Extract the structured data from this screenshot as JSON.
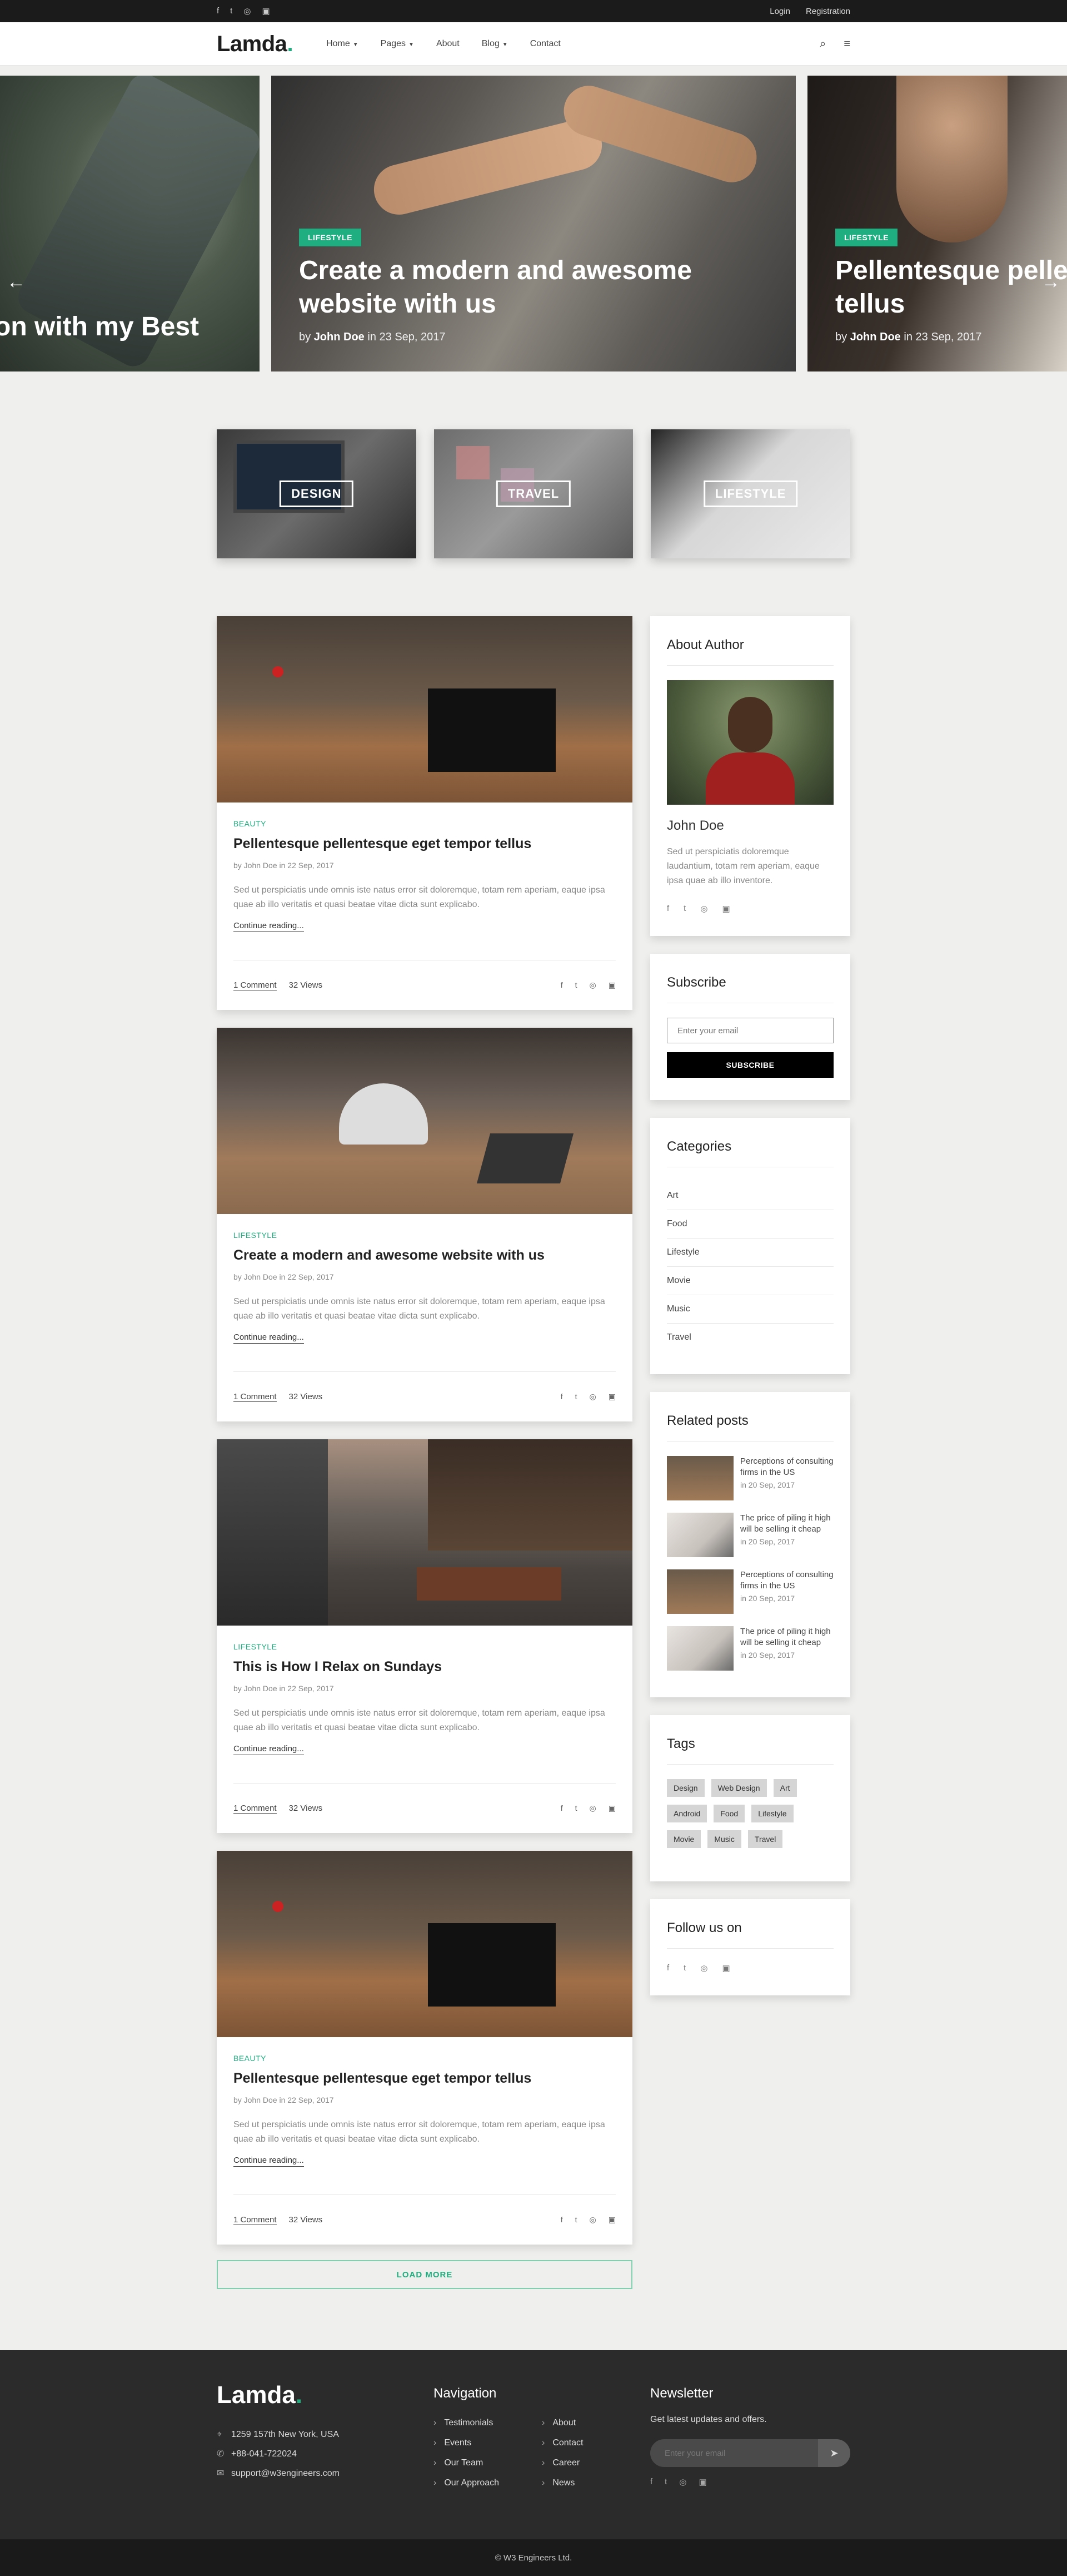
{
  "topbar": {
    "social_icons": [
      "f",
      "t",
      "◎",
      "▣"
    ],
    "login": "Login",
    "registration": "Registration"
  },
  "header": {
    "logo": "Lamda",
    "logo_dot": ".",
    "nav": [
      {
        "label": "Home",
        "has_dropdown": true
      },
      {
        "label": "Pages",
        "has_dropdown": true
      },
      {
        "label": "About",
        "has_dropdown": false
      },
      {
        "label": "Blog",
        "has_dropdown": true
      },
      {
        "label": "Contact",
        "has_dropdown": false
      }
    ],
    "search_icon": "⌕",
    "menu_icon": "≡"
  },
  "hero": {
    "slides": [
      {
        "badge": "",
        "title": "on with my Best",
        "author": "",
        "date": ""
      },
      {
        "badge": "LIFESTYLE",
        "title_line1": "Create a modern and awesome",
        "title_line2": "website with us",
        "by": "by",
        "author": "John Doe",
        "in": "in",
        "date": "23 Sep, 2017"
      },
      {
        "badge": "LIFESTYLE",
        "title_line1": "Pellentesque pellen",
        "title_line2": "tellus",
        "by": "by",
        "author": "John Doe",
        "in": "in",
        "date": "23 Sep, 2017"
      }
    ],
    "prev_arrow": "←",
    "next_arrow": "→"
  },
  "categories": [
    {
      "label": "DESIGN"
    },
    {
      "label": "TRAVEL"
    },
    {
      "label": "LIFESTYLE"
    }
  ],
  "posts": [
    {
      "category": "BEAUTY",
      "title": "Pellentesque pellentesque eget tempor tellus",
      "meta": "by John Doe in 22 Sep, 2017",
      "excerpt": "Sed ut perspiciatis unde omnis iste natus error sit doloremque, totam rem aperiam, eaque ipsa quae ab illo veritatis et quasi beatae vitae dicta sunt explicabo.",
      "more": "Continue reading...",
      "comments": "1 Comment",
      "views": "32 Views"
    },
    {
      "category": "LIFESTYLE",
      "title": "Create a modern and awesome website with us",
      "meta": "by John Doe in 22 Sep, 2017",
      "excerpt": "Sed ut perspiciatis unde omnis iste natus error sit doloremque, totam rem aperiam, eaque ipsa quae ab illo veritatis et quasi beatae vitae dicta sunt explicabo.",
      "more": "Continue reading...",
      "comments": "1 Comment",
      "views": "32 Views"
    },
    {
      "category": "LIFESTYLE",
      "title": "This is How I Relax on Sundays",
      "meta": "by John Doe in 22 Sep, 2017",
      "excerpt": "Sed ut perspiciatis unde omnis iste natus error sit doloremque, totam rem aperiam, eaque ipsa quae ab illo veritatis et quasi beatae vitae dicta sunt explicabo.",
      "more": "Continue reading...",
      "comments": "1 Comment",
      "views": "32 Views"
    },
    {
      "category": "BEAUTY",
      "title": "Pellentesque pellentesque eget tempor tellus",
      "meta": "by John Doe in 22 Sep, 2017",
      "excerpt": "Sed ut perspiciatis unde omnis iste natus error sit doloremque, totam rem aperiam, eaque ipsa quae ab illo veritatis et quasi beatae vitae dicta sunt explicabo.",
      "more": "Continue reading...",
      "comments": "1 Comment",
      "views": "32 Views"
    }
  ],
  "share_icons": [
    "f",
    "t",
    "◎",
    "▣"
  ],
  "load_more": "LOAD MORE",
  "sidebar": {
    "about": {
      "title": "About Author",
      "name": "John Doe",
      "bio": "Sed ut perspiciatis doloremque laudantium, totam rem aperiam, eaque ipsa quae ab illo inventore."
    },
    "subscribe": {
      "title": "Subscribe",
      "placeholder": "Enter your email",
      "button": "SUBSCRIBE"
    },
    "categories": {
      "title": "Categories",
      "items": [
        "Art",
        "Food",
        "Lifestyle",
        "Movie",
        "Music",
        "Travel"
      ]
    },
    "related": {
      "title": "Related posts",
      "items": [
        {
          "title": "Perceptions of consulting firms in the US",
          "date": "in 20 Sep, 2017"
        },
        {
          "title": "The price of piling it high will be selling it cheap",
          "date": "in 20 Sep, 2017"
        },
        {
          "title": "Perceptions of consulting firms in the US",
          "date": "in 20 Sep, 2017"
        },
        {
          "title": "The price of piling it high will be selling it cheap",
          "date": "in 20 Sep, 2017"
        }
      ]
    },
    "tags": {
      "title": "Tags",
      "items": [
        "Design",
        "Web Design",
        "Art",
        "Android",
        "Food",
        "Lifestyle",
        "Movie",
        "Music",
        "Travel"
      ]
    },
    "follow": {
      "title": "Follow us on"
    }
  },
  "footer": {
    "logo": "Lamda",
    "logo_dot": ".",
    "address": "1259 157th New York, USA",
    "phone": "+88-041-722024",
    "email": "support@w3engineers.com",
    "nav_title": "Navigation",
    "nav_left": [
      "Testimonials",
      "Events",
      "Our Team",
      "Our Approach"
    ],
    "nav_right": [
      "About",
      "Contact",
      "Career",
      "News"
    ],
    "newsletter_title": "Newsletter",
    "newsletter_text": "Get latest updates and offers.",
    "newsletter_placeholder": "Enter your email",
    "send_icon": "➤"
  },
  "copyright": "© W3 Engineers Ltd.",
  "colors": {
    "accent": "#1fae7f",
    "topbar": "#1b1b1b",
    "footer": "#2b2b2b"
  }
}
